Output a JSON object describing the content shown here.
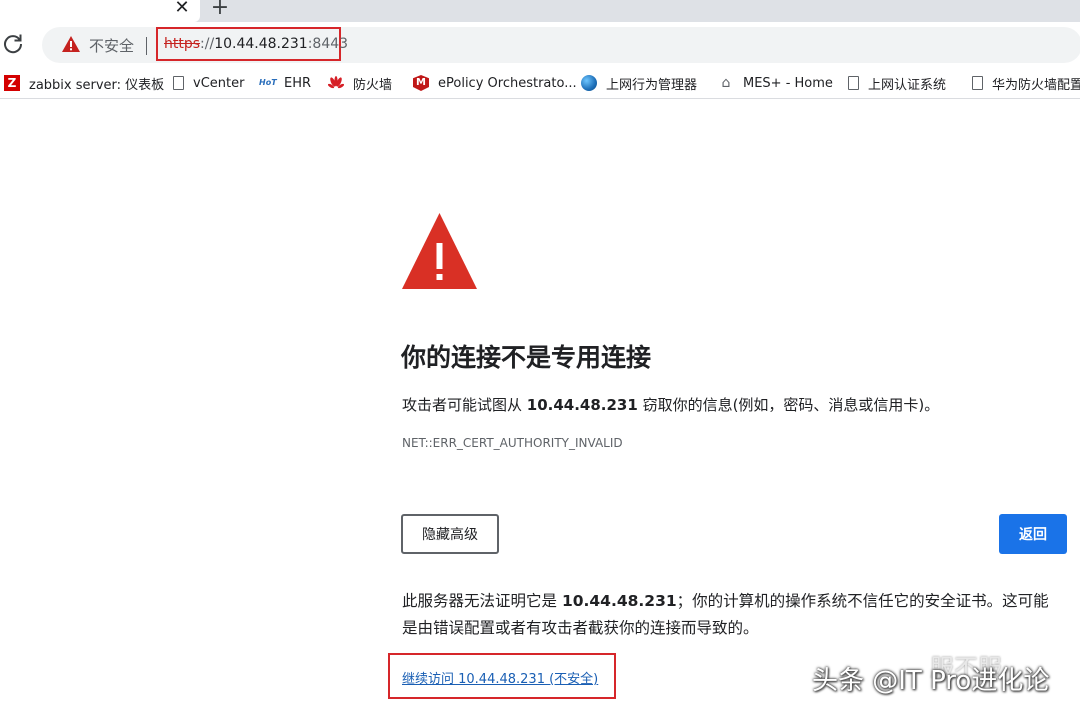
{
  "tab_bar": {
    "close_glyph": "✕",
    "new_tab_glyph": "+"
  },
  "address_bar": {
    "security_label": "不安全",
    "url_scheme": "https",
    "url_separator": "://",
    "url_host": "10.44.48.231",
    "url_port": ":8443"
  },
  "bookmarks": [
    {
      "label": "zabbix server: 仪表板",
      "icon": "zabbix-icon"
    },
    {
      "label": "vCenter",
      "icon": "document-icon"
    },
    {
      "label": "EHR",
      "icon": "hot-logo-icon"
    },
    {
      "label": "防火墙",
      "icon": "huawei-icon"
    },
    {
      "label": "ePolicy Orchestrato...",
      "icon": "mcafee-icon"
    },
    {
      "label": "上网行为管理器",
      "icon": "globe-icon"
    },
    {
      "label": "MES+ - Home",
      "icon": "home-icon"
    },
    {
      "label": "上网认证系统",
      "icon": "document-icon"
    },
    {
      "label": "华为防火墙配置",
      "icon": "document-icon"
    }
  ],
  "page": {
    "heading": "你的连接不是专用连接",
    "intro_before": "攻击者可能试图从 ",
    "intro_host": "10.44.48.231",
    "intro_after": " 窃取你的信息(例如，密码、消息或信用卡)。",
    "error_code": "NET::ERR_CERT_AUTHORITY_INVALID",
    "hide_advanced_button": "隐藏高级",
    "back_button": "返回",
    "explain_before": "此服务器无法证明它是 ",
    "explain_host": "10.44.48.231",
    "explain_after": "；你的计算机的操作系统不信任它的安全证书。这可能是由错误配置或者有攻击者截获你的连接而导致的。",
    "proceed_link": "继续访问 10.44.48.231 (不安全)"
  },
  "watermark": {
    "text": "头条 @IT Pro进化论",
    "upper_text": "服不服"
  },
  "colors": {
    "warning_red": "#d93025",
    "link_blue": "#1a5fb4",
    "primary_button": "#1a73e8",
    "annotation_red": "#d6262a"
  }
}
